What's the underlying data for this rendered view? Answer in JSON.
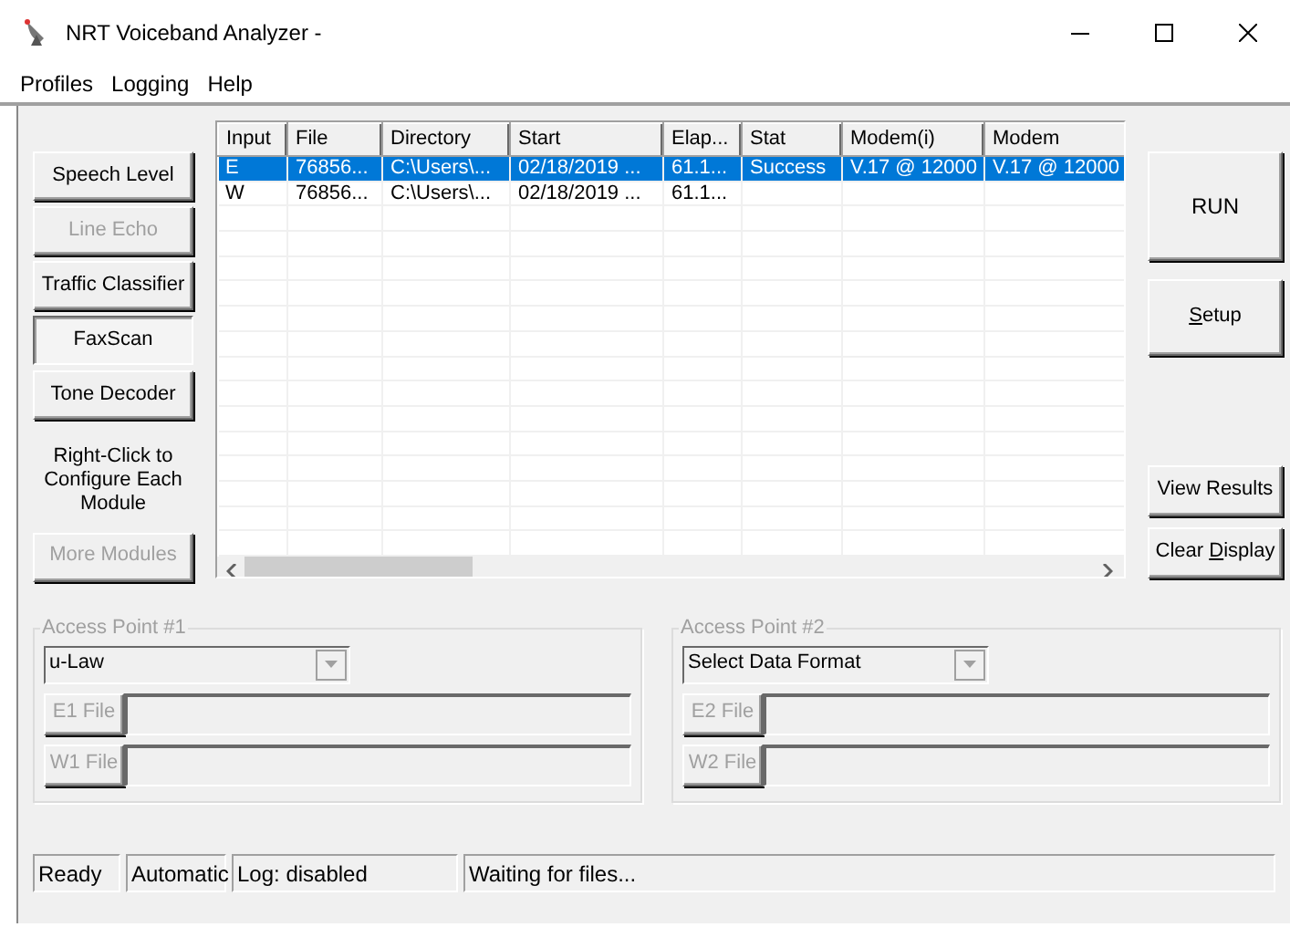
{
  "window": {
    "title": "NRT Voiceband Analyzer -"
  },
  "menu": [
    "Profiles",
    "Logging",
    "Help"
  ],
  "modules": [
    {
      "label": "Speech Level",
      "disabled": false,
      "pressed": false
    },
    {
      "label": "Line Echo",
      "disabled": true,
      "pressed": false
    },
    {
      "label": "Traffic Classifier",
      "disabled": false,
      "pressed": false
    },
    {
      "label": "FaxScan",
      "disabled": false,
      "pressed": true
    },
    {
      "label": "Tone Decoder",
      "disabled": false,
      "pressed": false
    }
  ],
  "hint": "Right-Click to Configure Each Module",
  "more_modules": {
    "label": "More Modules",
    "disabled": true
  },
  "table": {
    "columns": [
      "Input",
      "File",
      "Directory",
      "Start",
      "Elap...",
      "Stat",
      "Modem(i)",
      "Modem"
    ],
    "rows": [
      {
        "selected": true,
        "cells": [
          "E",
          "76856...",
          "C:\\Users\\...",
          "02/18/2019 ...",
          "61.1...",
          "Success",
          "V.17 @ 12000",
          "V.17 @ 12000"
        ]
      },
      {
        "selected": false,
        "cells": [
          "W",
          "76856...",
          "C:\\Users\\...",
          "02/18/2019 ...",
          "61.1..."
        ]
      }
    ]
  },
  "actions": [
    {
      "kind": "large",
      "pre": "RUN"
    },
    {
      "kind": "medium",
      "mnemonic": "S",
      "post": "etup"
    },
    {
      "kind": "gap",
      "pre": "View Results"
    },
    {
      "kind": "small",
      "pre": "Clear ",
      "mnemonic": "D",
      "post": "isplay"
    }
  ],
  "access_points": [
    {
      "title": "Access Point #1",
      "format": "u-Law",
      "files": [
        {
          "label": "E1 File",
          "disabled": true
        },
        {
          "label": "W1 File",
          "disabled": true
        }
      ]
    },
    {
      "title": "Access Point #2",
      "format": "Select Data Format",
      "files": [
        {
          "label": "E2 File",
          "disabled": true
        },
        {
          "label": "W2 File",
          "disabled": true
        }
      ]
    }
  ],
  "status_bar": [
    "Ready",
    "Automatic",
    "Log: disabled",
    "Waiting for files..."
  ]
}
